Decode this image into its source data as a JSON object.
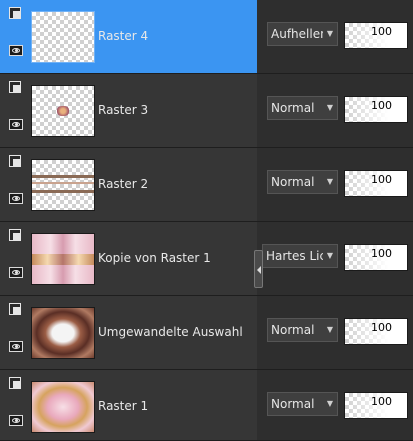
{
  "layers": [
    {
      "name": "Raster 4",
      "blend": "Aufhellen",
      "opacity": "100",
      "selected": true,
      "thumb": "empty"
    },
    {
      "name": "Raster 3",
      "blend": "Normal",
      "opacity": "100",
      "selected": false,
      "thumb": "small-object"
    },
    {
      "name": "Raster 2",
      "blend": "Normal",
      "opacity": "100",
      "selected": false,
      "thumb": "lines"
    },
    {
      "name": "Kopie von Raster 1",
      "blend": "Hartes Licht",
      "opacity": "100",
      "selected": false,
      "thumb": "pink-pattern"
    },
    {
      "name": "Umgewandelte Auswahl",
      "blend": "Normal",
      "opacity": "100",
      "selected": false,
      "thumb": "brown-frame"
    },
    {
      "name": "Raster 1",
      "blend": "Normal",
      "opacity": "100",
      "selected": false,
      "thumb": "pink-gold"
    }
  ],
  "icons": {
    "group": "layer-group-icon",
    "visibility": "eye-icon",
    "dropdown": "chevron-down-icon"
  },
  "colors": {
    "panel": "#363636",
    "selected": "#3b95f2",
    "text": "#e8e8e8"
  }
}
